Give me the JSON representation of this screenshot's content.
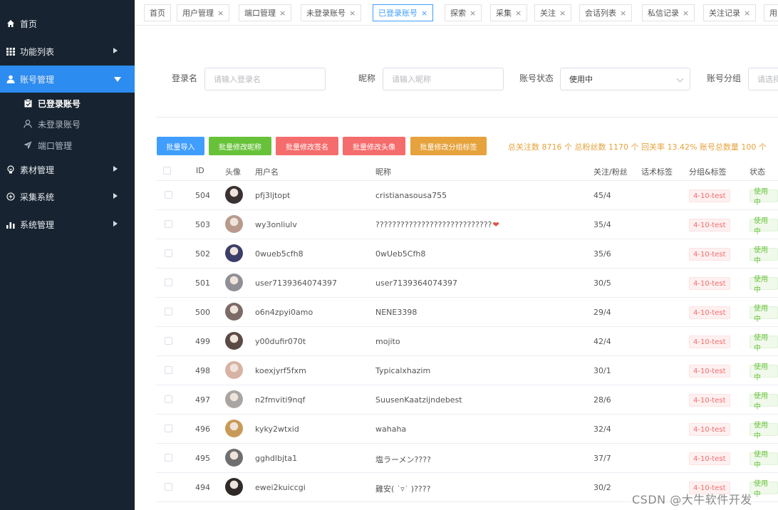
{
  "sidebar": {
    "items": [
      {
        "label": "首页",
        "icon": "home-icon"
      },
      {
        "label": "功能列表",
        "icon": "grid-icon"
      },
      {
        "label": "账号管理",
        "icon": "user-icon"
      },
      {
        "label": "素材管理",
        "icon": "bulb-icon"
      },
      {
        "label": "采集系统",
        "icon": "target-icon"
      },
      {
        "label": "系统管理",
        "icon": "bar-chart-icon"
      }
    ],
    "subitems": [
      {
        "label": "已登录账号",
        "icon": "clipboard-icon"
      },
      {
        "label": "未登录账号",
        "icon": "person-outline-icon"
      },
      {
        "label": "端口管理",
        "icon": "send-icon"
      }
    ]
  },
  "tabs": [
    "首页",
    "用户管理",
    "端口管理",
    "未登录账号",
    "已登录账号",
    "探索",
    "采集",
    "关注",
    "会话列表",
    "私信记录",
    "关注记录",
    "用"
  ],
  "tab_close": "×",
  "filters": {
    "login_label": "登录名",
    "login_placeholder": "请输入登录名",
    "nick_label": "昵称",
    "nick_placeholder": "请输入昵称",
    "status_label": "账号状态",
    "status_value": "使用中",
    "group_label": "账号分组",
    "group_placeholder": "请选择"
  },
  "actions": {
    "import": "批量导入",
    "edit_nick": "批量修改昵称",
    "edit_sign": "批量修改签名",
    "edit_avatar": "批量修改头像",
    "edit_group": "批量修改分组标签"
  },
  "stats": "总关注数 8716 个 总粉丝数 1170 个 回关率 13.42% 账号总数量 100 个",
  "table": {
    "headers": {
      "id": "ID",
      "avatar": "头像",
      "username": "用户名",
      "nickname": "昵称",
      "follow": "关注/粉丝",
      "tags": "话术标签",
      "group": "分组&标签",
      "status": "状态"
    },
    "rows": [
      {
        "id": "504",
        "username": "pfj3ljtopt",
        "nickname": "cristianasousa755",
        "follow": "45/4",
        "group": "4-10-test",
        "status": "使用中",
        "avatar_color": "#3a3232"
      },
      {
        "id": "503",
        "username": "wy3onliulv",
        "nickname": "????????????????????????????",
        "follow": "35/4",
        "group": "4-10-test",
        "status": "使用中",
        "avatar_color": "#b89a8c"
      },
      {
        "id": "502",
        "username": "0wueb5cfh8",
        "nickname": "0wUeb5Cfh8",
        "follow": "35/6",
        "group": "4-10-test",
        "status": "使用中",
        "avatar_color": "#3b3e68"
      },
      {
        "id": "501",
        "username": "user7139364074397",
        "nickname": "user7139364074397",
        "follow": "30/5",
        "group": "4-10-test",
        "status": "使用中",
        "avatar_color": "#8f8f95"
      },
      {
        "id": "500",
        "username": "o6n4zpyi0amo",
        "nickname": "NENE3398",
        "follow": "29/4",
        "group": "4-10-test",
        "status": "使用中",
        "avatar_color": "#7c6a66"
      },
      {
        "id": "499",
        "username": "y00dufir070t",
        "nickname": "mojito",
        "follow": "42/4",
        "group": "4-10-test",
        "status": "使用中",
        "avatar_color": "#5a4a43"
      },
      {
        "id": "498",
        "username": "koexjyrf5fxm",
        "nickname": "Typicalxhazim",
        "follow": "30/1",
        "group": "4-10-test",
        "status": "使用中",
        "avatar_color": "#d8b2a4"
      },
      {
        "id": "497",
        "username": "n2fmviti9nqf",
        "nickname": "SuusenKaatzijndebest",
        "follow": "28/6",
        "group": "4-10-test",
        "status": "使用中",
        "avatar_color": "#a8a5a3"
      },
      {
        "id": "496",
        "username": "kyky2wtxid",
        "nickname": "wahaha",
        "follow": "32/4",
        "group": "4-10-test",
        "status": "使用中",
        "avatar_color": "#c89a58"
      },
      {
        "id": "495",
        "username": "gghdlbjta1",
        "nickname": "塩ラーメン????",
        "follow": "37/7",
        "group": "4-10-test",
        "status": "使用中",
        "avatar_color": "#6f6f6f"
      },
      {
        "id": "494",
        "username": "ewei2kuiccgi",
        "nickname": "雞安( ˙▿˙ )????",
        "follow": "30/2",
        "group": "4-10-test",
        "status": "使用中",
        "avatar_color": "#2f2a28"
      }
    ]
  },
  "watermark": "CSDN @大牛软件开发"
}
